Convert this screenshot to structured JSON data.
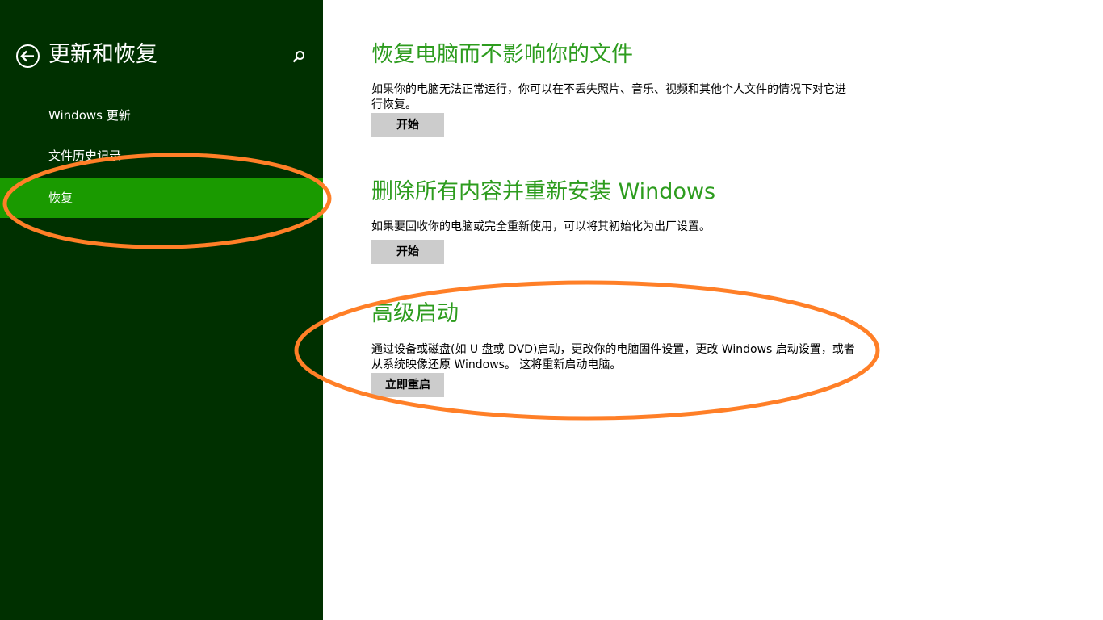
{
  "sidebar": {
    "title": "更新和恢复",
    "back_icon": "back-arrow-icon",
    "search_icon": "search-icon",
    "items": [
      {
        "label": "Windows 更新",
        "selected": false
      },
      {
        "label": "文件历史记录",
        "selected": false
      },
      {
        "label": "恢复",
        "selected": true
      }
    ],
    "background_color": "#003000",
    "selected_color": "#1a9a00"
  },
  "main": {
    "sections": [
      {
        "title": "恢复电脑而不影响你的文件",
        "description": "如果你的电脑无法正常运行，你可以在不丢失照片、音乐、视频和其他个人文件的情况下对它进行恢复。",
        "button": "开始"
      },
      {
        "title": "删除所有内容并重新安装 Windows",
        "description": "如果要回收你的电脑或完全重新使用，可以将其初始化为出厂设置。",
        "button": "开始"
      },
      {
        "title": "高级启动",
        "description": "通过设备或磁盘(如 U 盘或 DVD)启动，更改你的电脑固件设置，更改 Windows 启动设置，或者从系统映像还原 Windows。 这将重新启动电脑。",
        "button": "立即重启"
      }
    ],
    "heading_color": "#2d9c1e",
    "button_color": "#cccccc"
  },
  "annotation_color": "#ff7f27"
}
